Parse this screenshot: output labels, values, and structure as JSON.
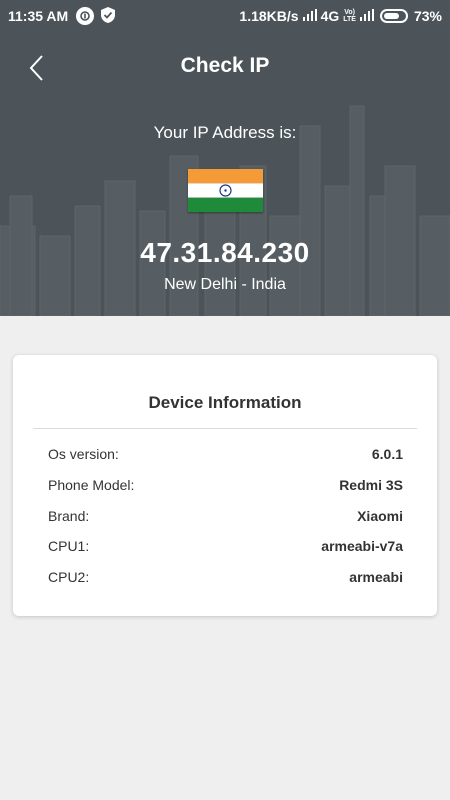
{
  "status_bar": {
    "time": "11:35 AM",
    "speed": "1.18KB/s",
    "network": "4G",
    "volte_top": "Vo)",
    "volte_bottom": "LTE",
    "battery": "73%",
    "battery_level": 0.73
  },
  "header": {
    "title": "Check IP",
    "ip_label": "Your IP Address is:",
    "ip_address": "47.31.84.230",
    "location": "New Delhi - India",
    "flag_country": "India",
    "bg_color": "#4c5459"
  },
  "device_info": {
    "title": "Device Information",
    "rows": [
      {
        "label": "Os version:",
        "value": "6.0.1"
      },
      {
        "label": "Phone Model:",
        "value": "Redmi 3S"
      },
      {
        "label": "Brand:",
        "value": "Xiaomi"
      },
      {
        "label": "CPU1:",
        "value": "armeabi-v7a"
      },
      {
        "label": "CPU2:",
        "value": "armeabi"
      }
    ]
  },
  "icons": {
    "back": "chevron-left-icon",
    "vpn": "vpn-key-icon",
    "shield": "shield-check-icon",
    "signal": "signal-bars-icon",
    "battery": "battery-icon"
  }
}
